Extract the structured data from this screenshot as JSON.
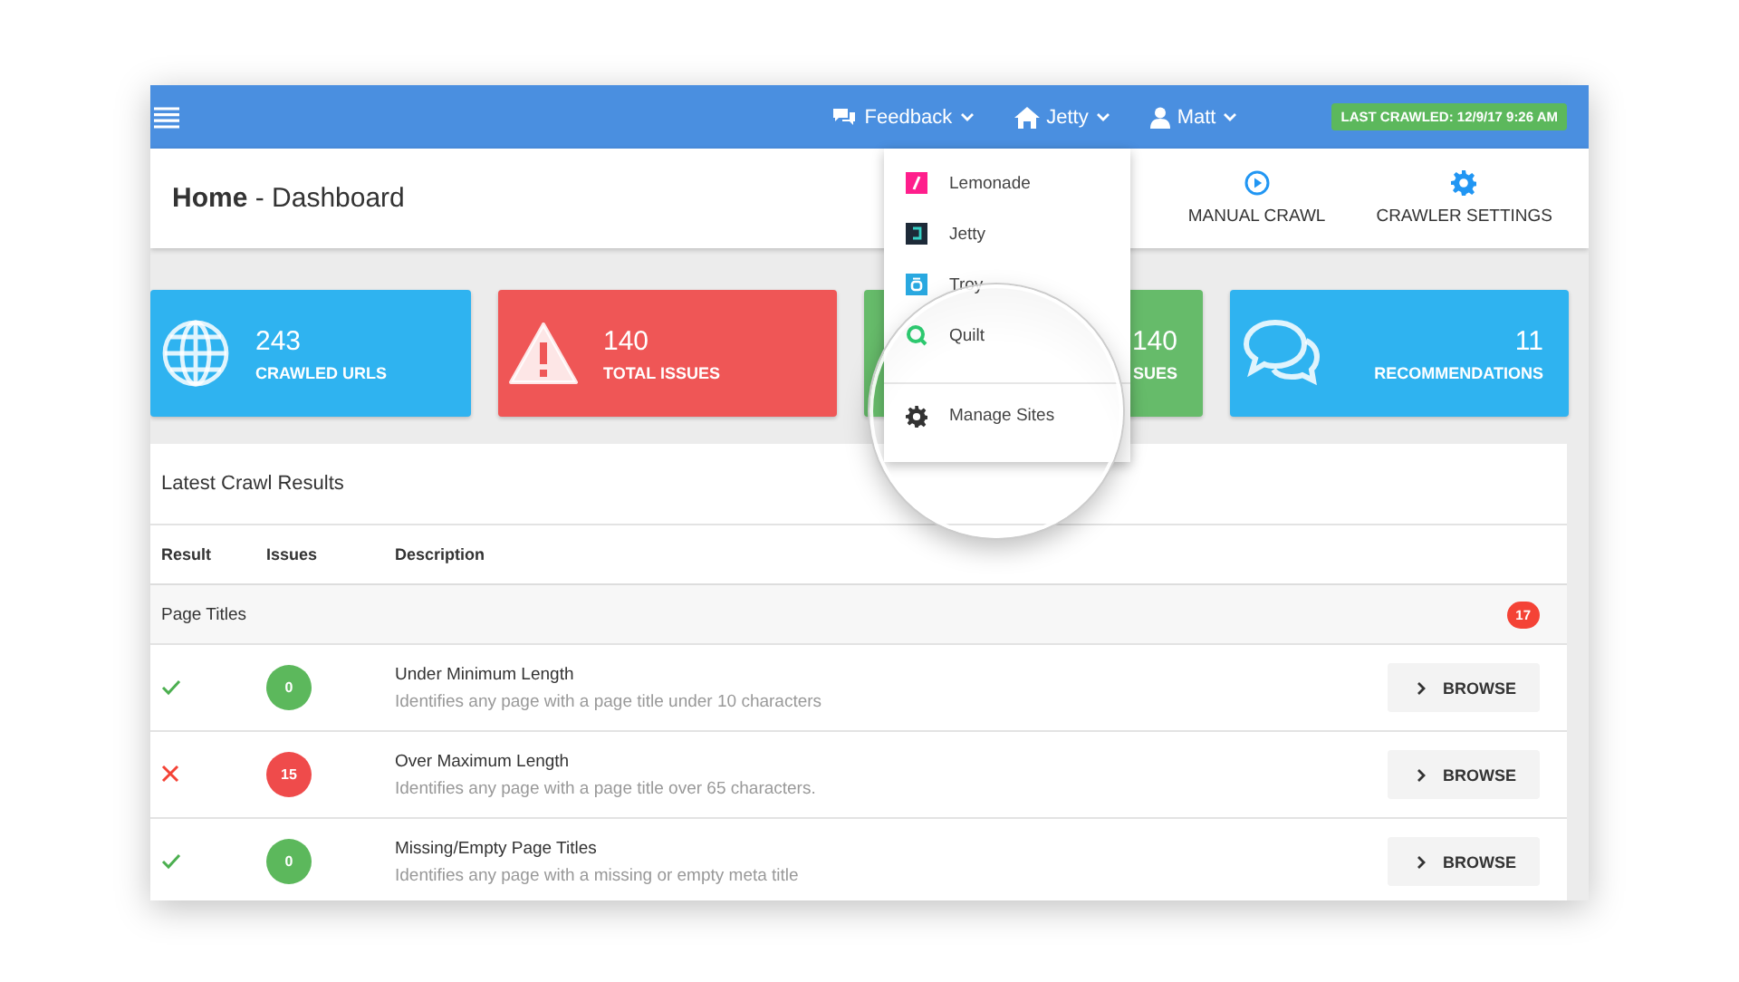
{
  "nav": {
    "items": [
      {
        "label": "Feedback",
        "kind": "feedback"
      },
      {
        "label": "Jetty",
        "kind": "home"
      },
      {
        "label": "Matt",
        "kind": "user"
      }
    ],
    "last_crawled": "LAST CRAWLED: 12/9/17 9:26 AM"
  },
  "page_header": {
    "title": "**Home** - Dashboard",
    "actions": [
      {
        "label": "MANUAL CRAWL",
        "kind": "play"
      },
      {
        "label": "CRAWLER SETTINGS",
        "kind": "gear"
      }
    ]
  },
  "stats": [
    {
      "value": "243",
      "label": "CRAWLED URLS",
      "color": "#2fb3f0",
      "kind": "globe"
    },
    {
      "value": "140",
      "label": "TOTAL ISSUES",
      "color": "#ef5656",
      "kind": "warning"
    },
    {
      "value": "140",
      "label": "SUES",
      "color": "#66bb6a",
      "kind": "none"
    },
    {
      "value": "11",
      "label": "RECOMMENDATIONS",
      "color": "#2fb3f0",
      "kind": "chat"
    }
  ],
  "site_menu": {
    "items": [
      {
        "label": "Lemonade",
        "kind": "lemonade"
      },
      {
        "label": "Jetty",
        "kind": "jetty"
      },
      {
        "label": "Troy",
        "kind": "troy"
      },
      {
        "label": "Quilt",
        "kind": "quilt"
      },
      {
        "label": "Manage Sites",
        "kind": "manage"
      }
    ]
  },
  "results": {
    "title": "Latest Crawl Results",
    "columns": [
      "Result",
      "Issues",
      "Description"
    ],
    "groups": [
      {
        "title": "Page Titles",
        "count": "17",
        "rows": [
          {
            "passed": true,
            "issues": "0",
            "title": "Under Minimum Length",
            "description": "Identifies any page with a page title under 10 characters",
            "action": "BROWSE"
          },
          {
            "passed": false,
            "issues": "15",
            "title": "Over Maximum Length",
            "description": "Identifies any page with a page title over 65 characters.",
            "action": "BROWSE"
          },
          {
            "passed": true,
            "issues": "0",
            "title": "Missing/Empty Page Titles",
            "description": "Identifies any page with a missing or empty meta title",
            "action": "BROWSE"
          }
        ]
      }
    ]
  }
}
